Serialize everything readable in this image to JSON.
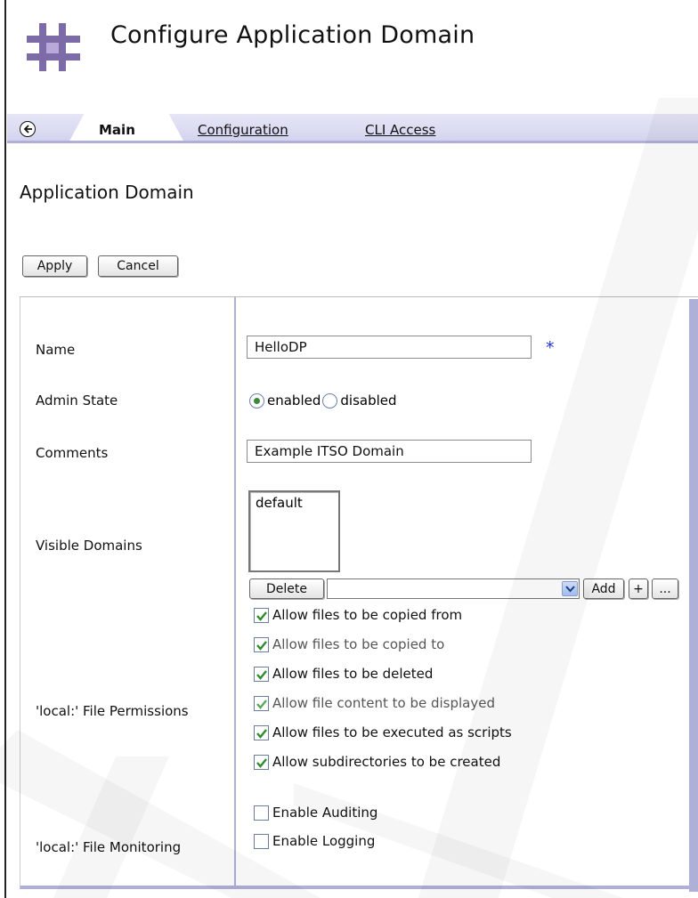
{
  "page": {
    "title": "Configure Application Domain"
  },
  "tabs": [
    {
      "label": "Main",
      "active": true
    },
    {
      "label": "Configuration",
      "active": false
    },
    {
      "label": "CLI Access",
      "active": false
    }
  ],
  "section": {
    "heading": "Application Domain"
  },
  "actions": {
    "apply_label": "Apply",
    "cancel_label": "Cancel"
  },
  "form": {
    "name": {
      "label": "Name",
      "value": "HelloDP",
      "required_mark": "*"
    },
    "admin_state": {
      "label": "Admin State",
      "options": [
        {
          "label": "enabled",
          "selected": true
        },
        {
          "label": "disabled",
          "selected": false
        }
      ]
    },
    "comments": {
      "label": "Comments",
      "value": "Example ITSO Domain"
    },
    "visible_domains": {
      "label": "Visible Domains",
      "list_items": [
        "default"
      ],
      "delete_label": "Delete",
      "select_value": "",
      "add_label": "Add",
      "plus_label": "+",
      "ellipsis_label": "..."
    },
    "file_permissions": {
      "label": "'local:' File Permissions",
      "options": [
        {
          "label": "Allow files to be copied from",
          "checked": true
        },
        {
          "label": "Allow files to be copied to",
          "checked": true
        },
        {
          "label": "Allow files to be deleted",
          "checked": true
        },
        {
          "label": "Allow file content to be displayed",
          "checked": true
        },
        {
          "label": "Allow files to be executed as scripts",
          "checked": true
        },
        {
          "label": "Allow subdirectories to be created",
          "checked": true
        }
      ]
    },
    "file_monitoring": {
      "label": "'local:' File Monitoring",
      "options": [
        {
          "label": "Enable Auditing",
          "checked": false
        },
        {
          "label": "Enable Logging",
          "checked": false
        }
      ]
    }
  },
  "colors": {
    "tab_bar": "#d2d2ee",
    "accent_border": "#aeb0d8",
    "required": "#2233cc",
    "check": "#2e8b2e"
  },
  "icons": {
    "logo": "hash-logo-icon",
    "back": "back-arrow-icon",
    "dropdown": "chevron-down-icon",
    "check": "checkmark-icon"
  }
}
